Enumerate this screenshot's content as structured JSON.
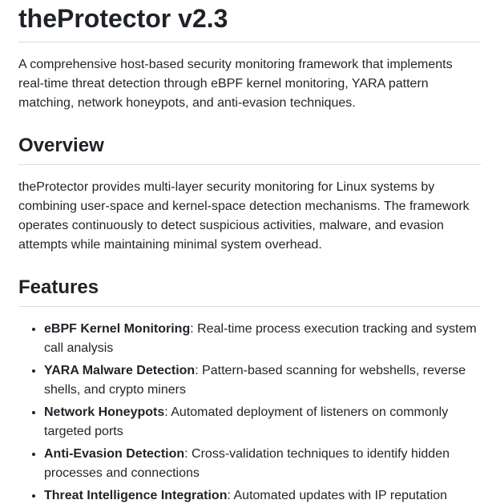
{
  "title": "theProtector v2.3",
  "intro": "A comprehensive host-based security monitoring framework that implements real-time threat detection through eBPF kernel monitoring, YARA pattern matching, network honeypots, and anti-evasion techniques.",
  "overview": {
    "heading": "Overview",
    "body": "theProtector provides multi-layer security monitoring for Linux systems by combining user-space and kernel-space detection mechanisms. The framework operates continuously to detect suspicious activities, malware, and evasion attempts while maintaining minimal system overhead."
  },
  "features": {
    "heading": "Features",
    "items": [
      {
        "name": "eBPF Kernel Monitoring",
        "desc": ": Real-time process execution tracking and system call analysis"
      },
      {
        "name": "YARA Malware Detection",
        "desc": ": Pattern-based scanning for webshells, reverse shells, and crypto miners"
      },
      {
        "name": "Network Honeypots",
        "desc": ": Automated deployment of listeners on commonly targeted ports"
      },
      {
        "name": "Anti-Evasion Detection",
        "desc": ": Cross-validation techniques to identify hidden processes and connections"
      },
      {
        "name": "Threat Intelligence Integration",
        "desc": ": Automated updates with IP reputation"
      }
    ]
  }
}
